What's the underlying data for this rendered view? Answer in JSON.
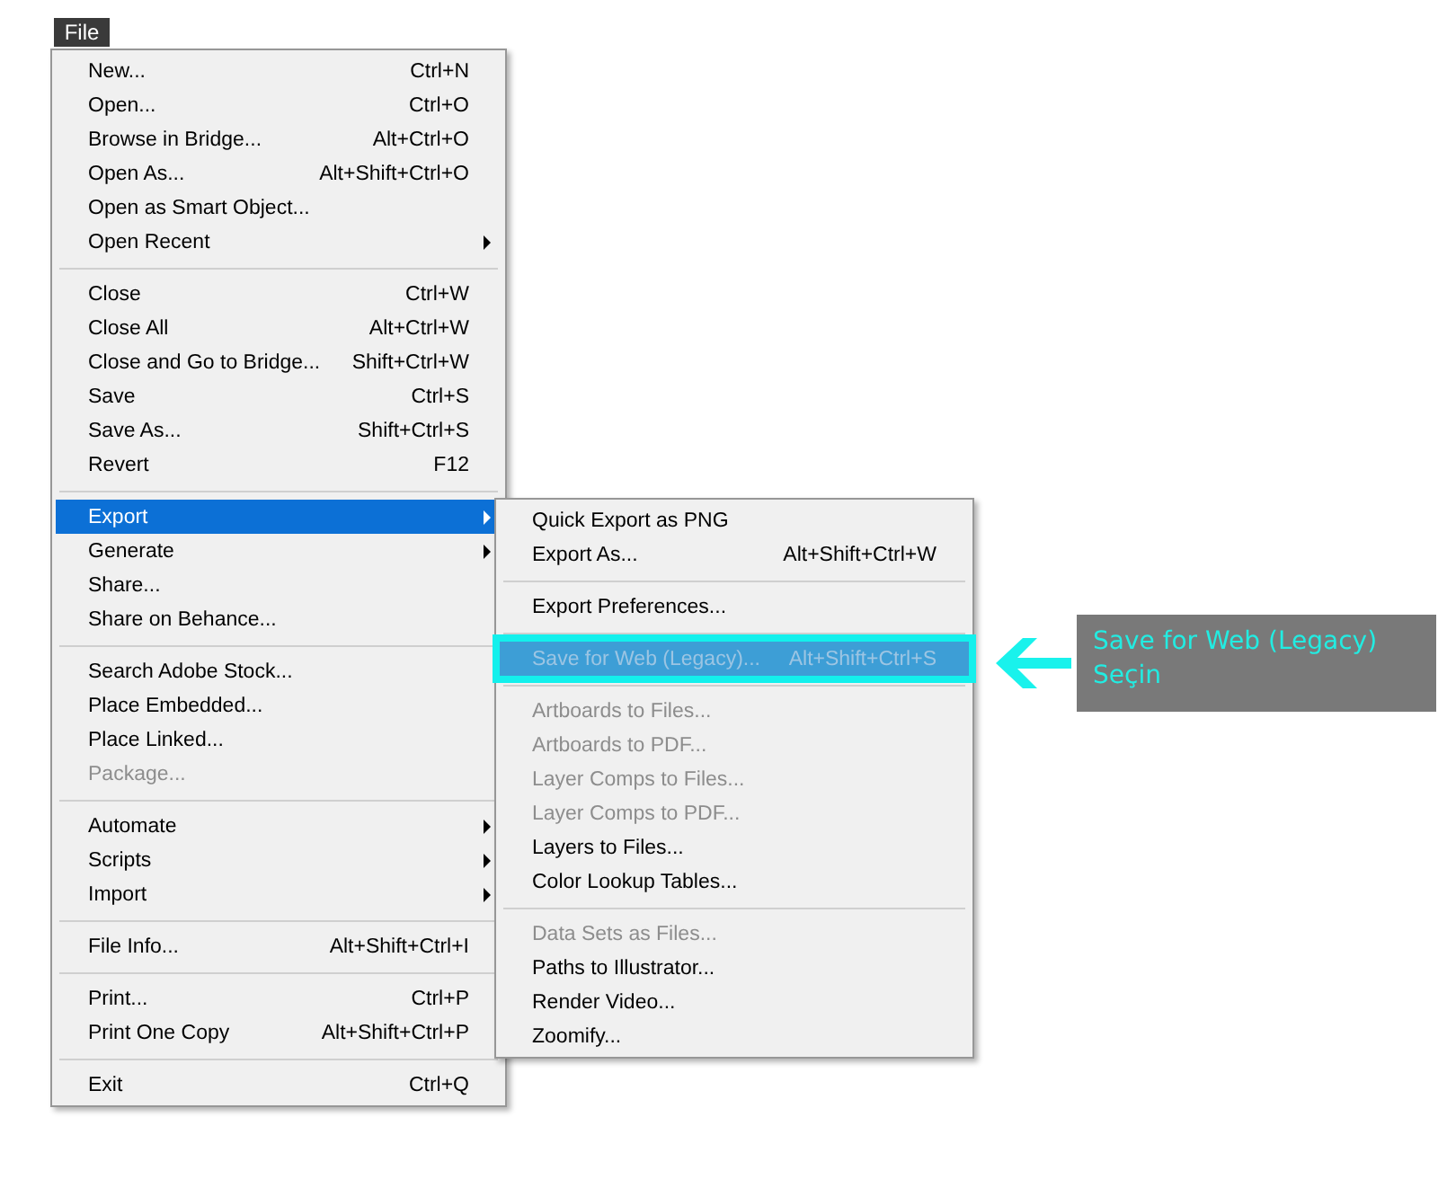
{
  "menu_title": "File",
  "menu": [
    {
      "kind": "item",
      "label": "New...",
      "shortcut": "Ctrl+N",
      "submenu": false,
      "disabled": false,
      "selected": false
    },
    {
      "kind": "item",
      "label": "Open...",
      "shortcut": "Ctrl+O",
      "submenu": false,
      "disabled": false,
      "selected": false
    },
    {
      "kind": "item",
      "label": "Browse in Bridge...",
      "shortcut": "Alt+Ctrl+O",
      "submenu": false,
      "disabled": false,
      "selected": false
    },
    {
      "kind": "item",
      "label": "Open As...",
      "shortcut": "Alt+Shift+Ctrl+O",
      "submenu": false,
      "disabled": false,
      "selected": false
    },
    {
      "kind": "item",
      "label": "Open as Smart Object...",
      "submenu": false,
      "disabled": false,
      "selected": false
    },
    {
      "kind": "item",
      "label": "Open Recent",
      "submenu": true,
      "disabled": false,
      "selected": false
    },
    {
      "kind": "separator"
    },
    {
      "kind": "item",
      "label": "Close",
      "shortcut": "Ctrl+W",
      "submenu": false,
      "disabled": false,
      "selected": false
    },
    {
      "kind": "item",
      "label": "Close All",
      "shortcut": "Alt+Ctrl+W",
      "submenu": false,
      "disabled": false,
      "selected": false
    },
    {
      "kind": "item",
      "label": "Close and Go to Bridge...",
      "shortcut": "Shift+Ctrl+W",
      "submenu": false,
      "disabled": false,
      "selected": false
    },
    {
      "kind": "item",
      "label": "Save",
      "shortcut": "Ctrl+S",
      "submenu": false,
      "disabled": false,
      "selected": false
    },
    {
      "kind": "item",
      "label": "Save As...",
      "shortcut": "Shift+Ctrl+S",
      "submenu": false,
      "disabled": false,
      "selected": false
    },
    {
      "kind": "item",
      "label": "Revert",
      "shortcut": "F12",
      "submenu": false,
      "disabled": false,
      "selected": false
    },
    {
      "kind": "separator"
    },
    {
      "kind": "item",
      "label": "Export",
      "submenu": true,
      "disabled": false,
      "selected": true
    },
    {
      "kind": "item",
      "label": "Generate",
      "submenu": true,
      "disabled": false,
      "selected": false
    },
    {
      "kind": "item",
      "label": "Share...",
      "submenu": false,
      "disabled": false,
      "selected": false
    },
    {
      "kind": "item",
      "label": "Share on Behance...",
      "submenu": false,
      "disabled": false,
      "selected": false
    },
    {
      "kind": "separator"
    },
    {
      "kind": "item",
      "label": "Search Adobe Stock...",
      "submenu": false,
      "disabled": false,
      "selected": false
    },
    {
      "kind": "item",
      "label": "Place Embedded...",
      "submenu": false,
      "disabled": false,
      "selected": false
    },
    {
      "kind": "item",
      "label": "Place Linked...",
      "submenu": false,
      "disabled": false,
      "selected": false
    },
    {
      "kind": "item",
      "label": "Package...",
      "submenu": false,
      "disabled": true,
      "selected": false
    },
    {
      "kind": "separator"
    },
    {
      "kind": "item",
      "label": "Automate",
      "submenu": true,
      "disabled": false,
      "selected": false
    },
    {
      "kind": "item",
      "label": "Scripts",
      "submenu": true,
      "disabled": false,
      "selected": false
    },
    {
      "kind": "item",
      "label": "Import",
      "submenu": true,
      "disabled": false,
      "selected": false
    },
    {
      "kind": "separator"
    },
    {
      "kind": "item",
      "label": "File Info...",
      "shortcut": "Alt+Shift+Ctrl+I",
      "submenu": false,
      "disabled": false,
      "selected": false
    },
    {
      "kind": "separator"
    },
    {
      "kind": "item",
      "label": "Print...",
      "shortcut": "Ctrl+P",
      "submenu": false,
      "disabled": false,
      "selected": false
    },
    {
      "kind": "item",
      "label": "Print One Copy",
      "shortcut": "Alt+Shift+Ctrl+P",
      "submenu": false,
      "disabled": false,
      "selected": false
    },
    {
      "kind": "separator"
    },
    {
      "kind": "item",
      "label": "Exit",
      "shortcut": "Ctrl+Q",
      "submenu": false,
      "disabled": false,
      "selected": false
    }
  ],
  "submenu": [
    {
      "kind": "item",
      "label": "Quick Export as PNG",
      "disabled": false,
      "selected": false,
      "outlined": false
    },
    {
      "kind": "item",
      "label": "Export As...",
      "shortcut": "Alt+Shift+Ctrl+W",
      "disabled": false,
      "selected": false,
      "outlined": false
    },
    {
      "kind": "separator"
    },
    {
      "kind": "item",
      "label": "Export Preferences...",
      "disabled": false,
      "selected": false,
      "outlined": false
    },
    {
      "kind": "separator"
    },
    {
      "kind": "item",
      "label": "Save for Web (Legacy)...",
      "shortcut": "Alt+Shift+Ctrl+S",
      "disabled": true,
      "selected": true,
      "outlined": true
    },
    {
      "kind": "separator"
    },
    {
      "kind": "item",
      "label": "Artboards to Files...",
      "disabled": true,
      "selected": false,
      "outlined": false
    },
    {
      "kind": "item",
      "label": "Artboards to PDF...",
      "disabled": true,
      "selected": false,
      "outlined": false
    },
    {
      "kind": "item",
      "label": "Layer Comps to Files...",
      "disabled": true,
      "selected": false,
      "outlined": false
    },
    {
      "kind": "item",
      "label": "Layer Comps to PDF...",
      "disabled": true,
      "selected": false,
      "outlined": false
    },
    {
      "kind": "item",
      "label": "Layers to Files...",
      "disabled": false,
      "selected": false,
      "outlined": false
    },
    {
      "kind": "item",
      "label": "Color Lookup Tables...",
      "disabled": false,
      "selected": false,
      "outlined": false
    },
    {
      "kind": "separator"
    },
    {
      "kind": "item",
      "label": "Data Sets as Files...",
      "disabled": true,
      "selected": false,
      "outlined": false
    },
    {
      "kind": "item",
      "label": "Paths to Illustrator...",
      "disabled": false,
      "selected": false,
      "outlined": false
    },
    {
      "kind": "item",
      "label": "Render Video...",
      "disabled": false,
      "selected": false,
      "outlined": false
    },
    {
      "kind": "item",
      "label": "Zoomify...",
      "disabled": false,
      "selected": false,
      "outlined": false
    }
  ],
  "callout": {
    "lines": [
      "Save for Web (Legacy)",
      "Seçin"
    ]
  }
}
